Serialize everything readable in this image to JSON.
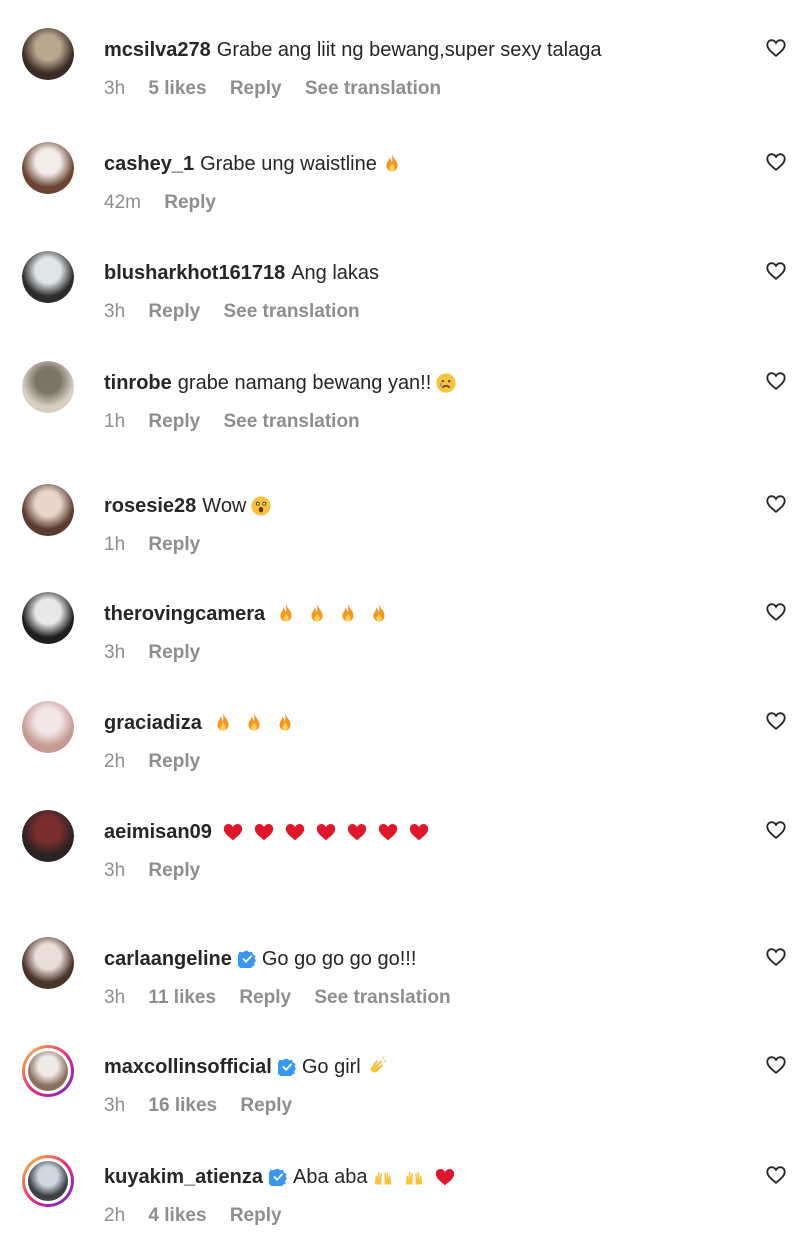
{
  "comments": [
    {
      "username": "mcsilva278",
      "text": "Grabe ang liit ng bewang,super sexy talaga",
      "time": "3h",
      "likes": "5 likes",
      "reply": "Reply",
      "translation": "See translation",
      "verified": false,
      "emojis": [],
      "avatar_colors": [
        "#b9a88f",
        "#3a2c24"
      ]
    },
    {
      "username": "cashey_1",
      "text": "Grabe ung waistline",
      "time": "42m",
      "likes": "",
      "reply": "Reply",
      "translation": "",
      "verified": false,
      "emojis": [
        "fire-emoji"
      ],
      "avatar_colors": [
        "#f1ece8",
        "#6b4433"
      ]
    },
    {
      "username": "blusharkhot161718",
      "text": "Ang lakas",
      "time": "3h",
      "likes": "",
      "reply": "Reply",
      "translation": "See translation",
      "verified": false,
      "emojis": [],
      "avatar_colors": [
        "#dfe6ea",
        "#2c2a2b"
      ]
    },
    {
      "username": "tinrobe",
      "text": "grabe namang bewang yan!!",
      "time": "1h",
      "likes": "",
      "reply": "Reply",
      "translation": "See translation",
      "verified": false,
      "emojis": [
        "crying-face-emoji"
      ],
      "avatar_colors": [
        "#7d7468",
        "#d8cfc2"
      ]
    },
    {
      "username": "rosesie28",
      "text": "Wow",
      "time": "1h",
      "likes": "",
      "reply": "Reply",
      "translation": "",
      "verified": false,
      "emojis": [
        "astonished-face-emoji"
      ],
      "avatar_colors": [
        "#e9d6cb",
        "#5a3b2d"
      ]
    },
    {
      "username": "therovingcamera",
      "text": "",
      "time": "3h",
      "likes": "",
      "reply": "Reply",
      "translation": "",
      "verified": false,
      "emojis": [
        "fire-emoji",
        "fire-emoji",
        "fire-emoji",
        "fire-emoji"
      ],
      "avatar_colors": [
        "#e8e8e8",
        "#1e1e1e"
      ]
    },
    {
      "username": "graciadiza",
      "text": "",
      "time": "2h",
      "likes": "",
      "reply": "Reply",
      "translation": "",
      "verified": false,
      "emojis": [
        "fire-emoji",
        "fire-emoji",
        "fire-emoji"
      ],
      "avatar_colors": [
        "#f3e6e6",
        "#c59a94"
      ]
    },
    {
      "username": "aeimisan09",
      "text": "",
      "time": "3h",
      "likes": "",
      "reply": "Reply",
      "translation": "",
      "verified": false,
      "emojis": [
        "red-heart-emoji",
        "red-heart-emoji",
        "red-heart-emoji",
        "red-heart-emoji",
        "red-heart-emoji",
        "red-heart-emoji",
        "red-heart-emoji"
      ],
      "avatar_colors": [
        "#7a2e2e",
        "#2b2222"
      ]
    },
    {
      "username": "carlaangeline",
      "text": "Go go go go go!!!",
      "time": "3h",
      "likes": "11 likes",
      "reply": "Reply",
      "translation": "See translation",
      "verified": true,
      "emojis": [],
      "avatar_colors": [
        "#eadfd8",
        "#4a3328"
      ]
    },
    {
      "username": "maxcollinsofficial",
      "text": "Go girl",
      "time": "3h",
      "likes": "16 likes",
      "reply": "Reply",
      "translation": "",
      "verified": true,
      "emojis": [
        "clapping-hands-emoji"
      ],
      "avatar_colors": [
        "#f0ebe6",
        "#8a6f5e"
      ],
      "story_ring": true
    },
    {
      "username": "kuyakim_atienza",
      "text": "Aba aba",
      "time": "2h",
      "likes": "4 likes",
      "reply": "Reply",
      "translation": "",
      "verified": true,
      "emojis": [
        "raising-hands-emoji",
        "raising-hands-emoji",
        "red-heart-emoji"
      ],
      "avatar_colors": [
        "#cfd9e2",
        "#3d3f44"
      ],
      "story_ring": true
    }
  ],
  "colors": {
    "text": "#262626",
    "meta": "#8e8e8e",
    "verified": "#3897f0",
    "heart_outline": "#262626"
  }
}
